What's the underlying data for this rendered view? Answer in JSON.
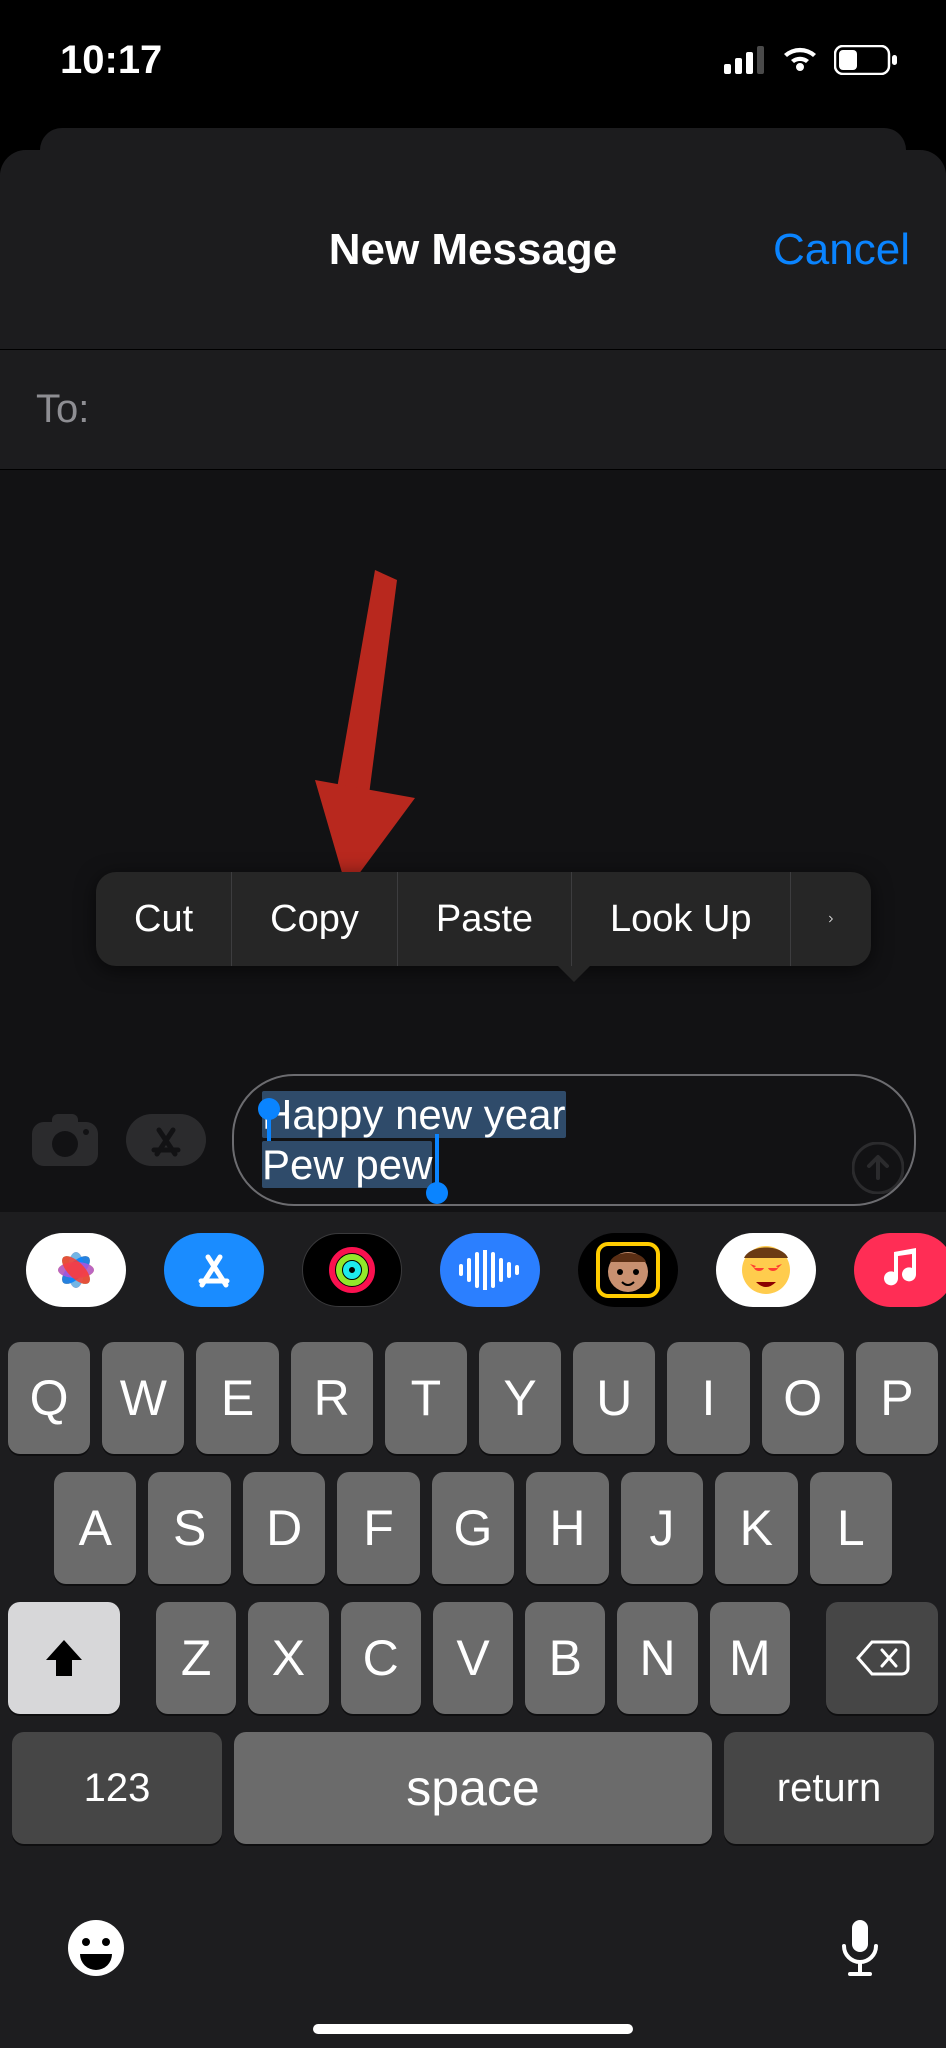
{
  "status": {
    "time": "10:17"
  },
  "nav": {
    "title": "New Message",
    "cancel": "Cancel"
  },
  "to": {
    "label": "To:"
  },
  "callout": {
    "cut": "Cut",
    "copy": "Copy",
    "paste": "Paste",
    "lookup": "Look Up"
  },
  "compose": {
    "line1": "Happy new year",
    "line2": "Pew pew"
  },
  "appstrip": {
    "photos": "photos",
    "appstore": "appstore",
    "activity": "activity",
    "audio": "audio",
    "memoji": "memoji",
    "animoji": "animoji",
    "music": "music"
  },
  "keyboard": {
    "row1": [
      "Q",
      "W",
      "E",
      "R",
      "T",
      "Y",
      "U",
      "I",
      "O",
      "P"
    ],
    "row2": [
      "A",
      "S",
      "D",
      "F",
      "G",
      "H",
      "J",
      "K",
      "L"
    ],
    "row3": [
      "Z",
      "X",
      "C",
      "V",
      "B",
      "N",
      "M"
    ],
    "num": "123",
    "space": "space",
    "ret": "return"
  }
}
